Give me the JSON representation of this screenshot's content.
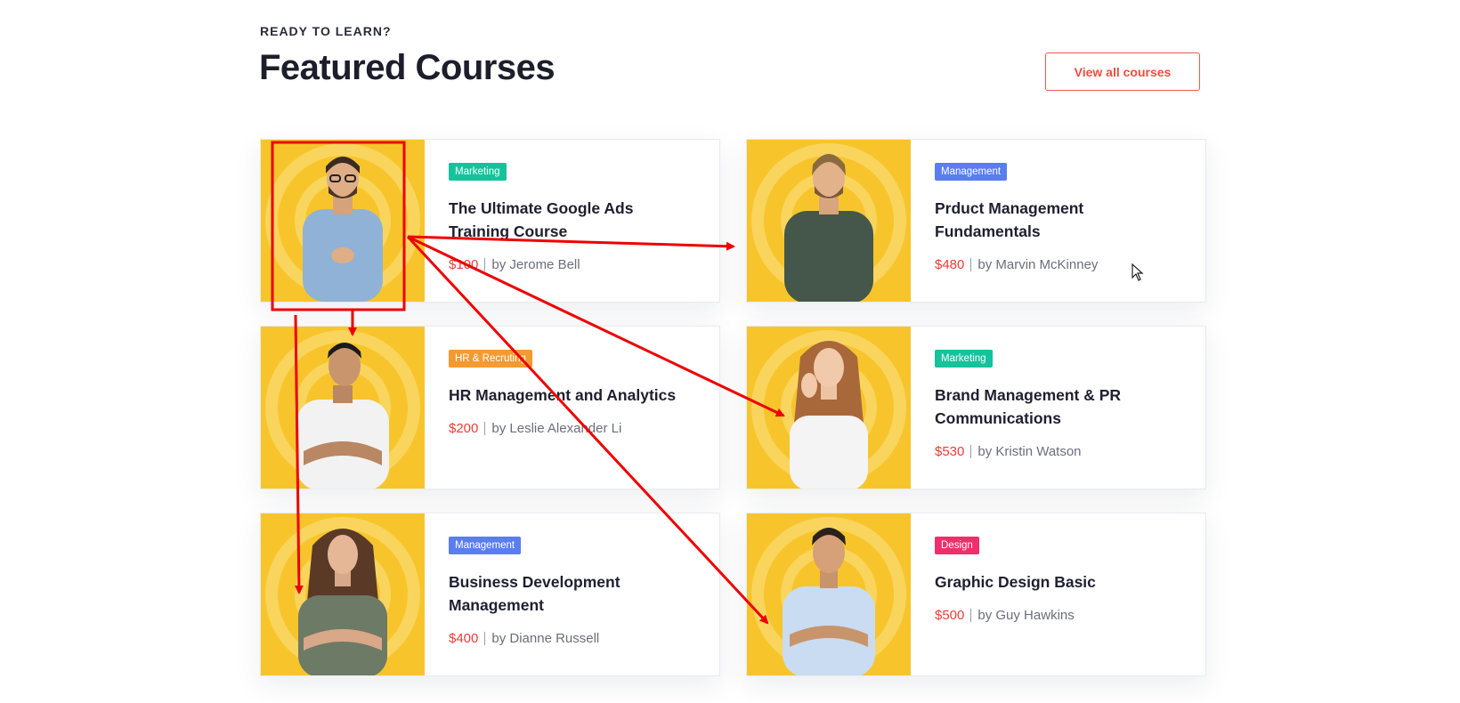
{
  "section": {
    "eyebrow": "READY TO LEARN?",
    "title": "Featured Courses",
    "view_all_label": "View all courses"
  },
  "colors": {
    "accent": "#ef4e3c",
    "thumb_bg": "#f7c52b",
    "marketing": "#14c39b",
    "management": "#5a7df0",
    "hr": "#f59a31",
    "design": "#ef2f6b",
    "annotation": "#ee0000"
  },
  "courses": [
    {
      "category": "Marketing",
      "title": "The Ultimate Google Ads Training Course",
      "price": "$100",
      "instructor": "by Jerome Bell",
      "icon": "instructor-photo"
    },
    {
      "category": "Management",
      "title": "Prduct Management Fundamentals",
      "price": "$480",
      "instructor": "by Marvin McKinney",
      "icon": "instructor-photo"
    },
    {
      "category": "HR & Recruting",
      "title": "HR  Management and Analytics",
      "price": "$200",
      "instructor": "by Leslie Alexander Li",
      "icon": "instructor-photo"
    },
    {
      "category": "Marketing",
      "title": "Brand Management & PR Communications",
      "price": "$530",
      "instructor": "by Kristin Watson",
      "icon": "instructor-photo"
    },
    {
      "category": "Management",
      "title": "Business Development Management",
      "price": "$400",
      "instructor": "by Dianne Russell",
      "icon": "instructor-photo"
    },
    {
      "category": "Design",
      "title": "Graphic Design Basic",
      "price": "$500",
      "instructor": "by Guy Hawkins",
      "icon": "instructor-photo"
    }
  ]
}
